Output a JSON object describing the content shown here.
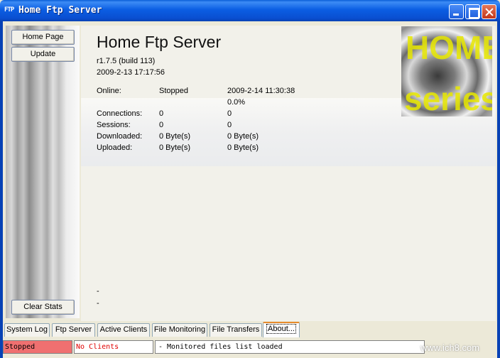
{
  "window": {
    "app_icon_text": "FTP",
    "title": "Home Ftp Server"
  },
  "sidebar": {
    "home_page": "Home Page",
    "update": "Update",
    "clear_stats": "Clear Stats"
  },
  "main": {
    "title": "Home Ftp Server",
    "version": "r1.7.5 (build 113)",
    "build_date": "2009-2-13 17:17:56",
    "stats": [
      {
        "label": "Online:",
        "value": "Stopped",
        "value2": "2009-2-14 11:30:38"
      },
      {
        "label": "",
        "value": "",
        "value2": "0.0%"
      },
      {
        "label": "Connections:",
        "value": "0",
        "value2": "0"
      },
      {
        "label": "Sessions:",
        "value": "0",
        "value2": "0"
      },
      {
        "label": "Downloaded:",
        "value": "0 Byte(s)",
        "value2": "0 Byte(s)"
      },
      {
        "label": "Uploaded:",
        "value": "0 Byte(s)",
        "value2": "0 Byte(s)"
      }
    ],
    "dash1": "-",
    "dash2": "-",
    "logo": {
      "line1": "HOME",
      "line2": "series",
      "color": "#e8e800"
    }
  },
  "tabs": [
    {
      "label": "System Log",
      "active": false
    },
    {
      "label": "Ftp Server",
      "active": false
    },
    {
      "label": "Active Clients",
      "active": false
    },
    {
      "label": "File Monitoring",
      "active": false
    },
    {
      "label": "File Transfers",
      "active": false
    },
    {
      "label": "About...",
      "active": true
    }
  ],
  "status": {
    "state": "Stopped",
    "clients": "No Clients",
    "message": "- Monitored files list loaded",
    "state_color": "#f07070",
    "clients_color": "#e00000"
  },
  "watermark": "www.ich8.com"
}
